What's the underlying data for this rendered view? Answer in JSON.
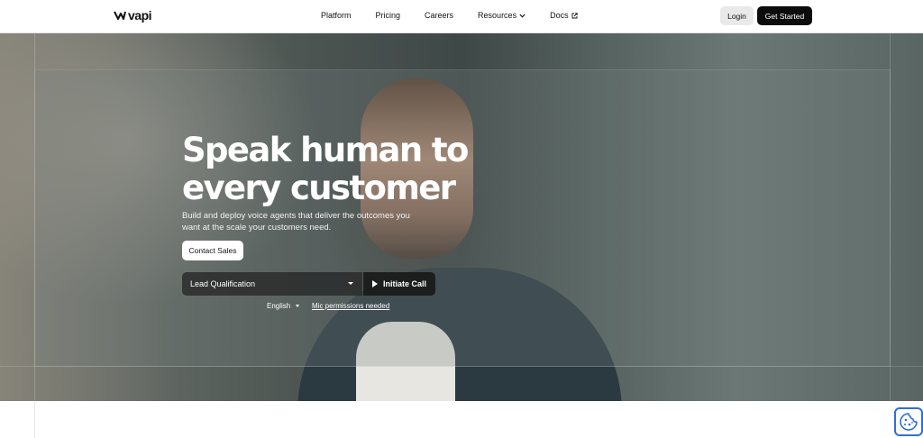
{
  "brand": {
    "name": "vapi",
    "logo_icon": "vapi-logo-icon"
  },
  "nav": {
    "links": [
      {
        "label": "Platform"
      },
      {
        "label": "Pricing"
      },
      {
        "label": "Careers"
      },
      {
        "label": "Resources",
        "icon": "chevron-down-icon"
      },
      {
        "label": "Docs",
        "icon": "external-link-icon"
      }
    ],
    "login_label": "Login",
    "get_started_label": "Get Started"
  },
  "hero": {
    "headline_line1": "Speak human to",
    "headline_line2": "every customer",
    "sub_line1": "Build and deploy voice agents that deliver the outcomes you",
    "sub_line2": "want at the scale your customers need.",
    "contact_label": "Contact Sales",
    "demo": {
      "selected_agent": "Lead Qualification",
      "call_label": "Initiate Call",
      "language": "English",
      "mic_notice": "Mic permissions needed"
    }
  },
  "colors": {
    "accent": "#0c0c0c",
    "cookie_border": "#2e6fd8"
  },
  "cookie": {
    "icon": "cookie-icon"
  }
}
